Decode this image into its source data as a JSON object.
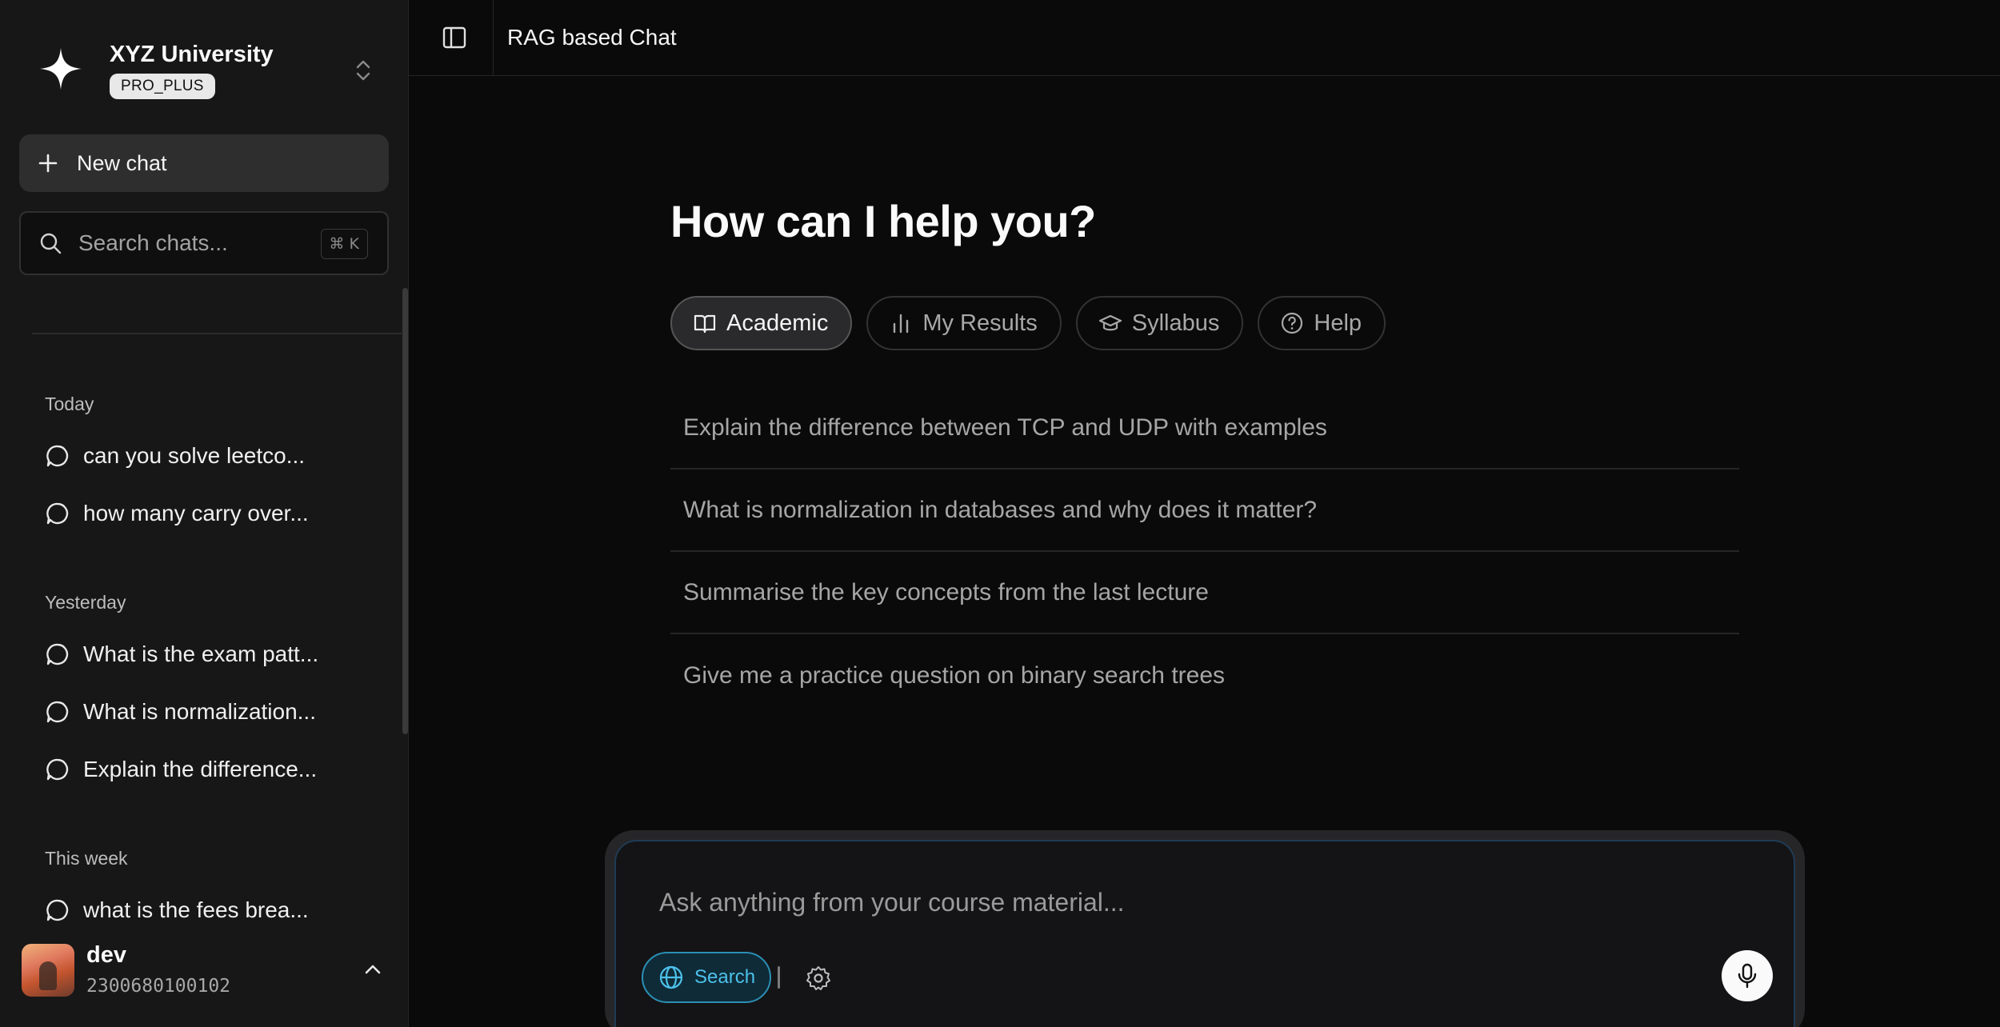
{
  "sidebar": {
    "brand": {
      "name": "XYZ University",
      "plan": "PRO_PLUS"
    },
    "new_chat_label": "New chat",
    "search": {
      "placeholder": "Search chats...",
      "shortcut": "⌘ K"
    },
    "groups": [
      {
        "title": "Today",
        "items": [
          "can you solve leetco...",
          "how many carry over..."
        ]
      },
      {
        "title": "Yesterday",
        "items": [
          "What is the exam patt...",
          "What is normalization...",
          "Explain the difference..."
        ]
      },
      {
        "title": "This week",
        "items": [
          "what is the fees brea..."
        ]
      }
    ],
    "user": {
      "name": "dev",
      "id": "2300680100102"
    }
  },
  "topbar": {
    "title": "RAG based Chat"
  },
  "main": {
    "heading": "How can I help you?",
    "tabs": [
      {
        "label": "Academic",
        "icon": "book-open-icon",
        "active": true
      },
      {
        "label": "My Results",
        "icon": "bar-chart-icon",
        "active": false
      },
      {
        "label": "Syllabus",
        "icon": "graduation-cap-icon",
        "active": false
      },
      {
        "label": "Help",
        "icon": "help-circle-icon",
        "active": false
      }
    ],
    "suggestions": [
      "Explain the difference between TCP and UDP with examples",
      "What is normalization in databases and why does it matter?",
      "Summarise the key concepts from the last lecture",
      "Give me a practice question on binary search trees"
    ]
  },
  "composer": {
    "placeholder": "Ask anything from your course material...",
    "search_label": "Search"
  },
  "colors": {
    "accent": "#4cc1ea",
    "background": "#0a0a0b",
    "sidebar": "#171717"
  }
}
